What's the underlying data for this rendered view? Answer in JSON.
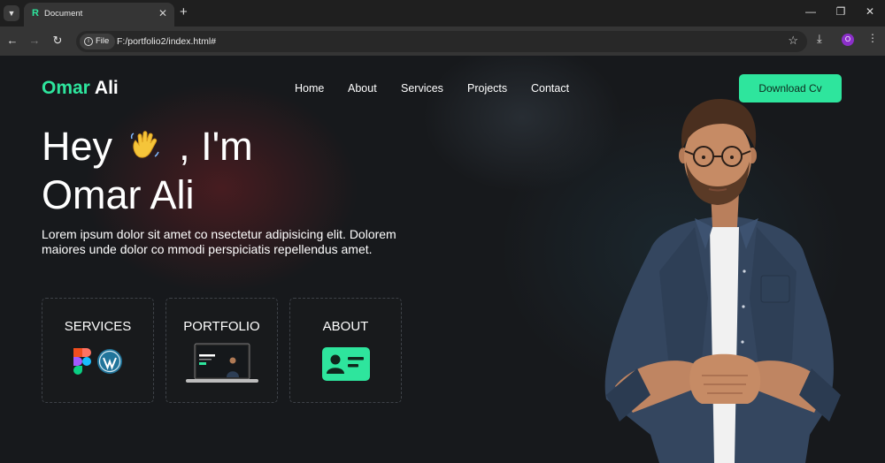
{
  "browser": {
    "tab_title": "Document",
    "tab_favicon": "R",
    "tab_close": "✕",
    "new_tab": "+",
    "url_chip": "File",
    "url": "F:/portfolio2/index.html#",
    "profile_initial": "O",
    "icons": [
      "tab-search-icon",
      "back-icon",
      "forward-icon",
      "reload-icon",
      "info-icon",
      "star-icon",
      "download-icon",
      "menu-icon",
      "minimize-icon",
      "restore-icon",
      "close-icon"
    ]
  },
  "page": {
    "logo": {
      "first": "Omar",
      "last": "Ali"
    },
    "nav": [
      "Home",
      "About",
      "Services",
      "Projects",
      "Contact"
    ],
    "cta": "Download Cv",
    "hero": {
      "greeting_pre": "Hey",
      "greeting_post": ", I'm",
      "name": "Omar Ali",
      "description": "Lorem ipsum dolor sit amet co nsectetur adipisicing elit. Dolorem maiores unde dolor co mmodi perspiciatis repellendus amet."
    },
    "cards": [
      {
        "title": "SERVICES",
        "icons": [
          "figma-icon",
          "wordpress-icon"
        ]
      },
      {
        "title": "PORTFOLIO",
        "icons": [
          "laptop-preview-icon"
        ]
      },
      {
        "title": "ABOUT",
        "icons": [
          "id-card-icon"
        ]
      }
    ]
  },
  "colors": {
    "accent": "#2ee59d",
    "background": "#17191c",
    "text": "#ffffff",
    "browser_frame": "#1f1f1f",
    "browser_toolbar": "#353535"
  }
}
